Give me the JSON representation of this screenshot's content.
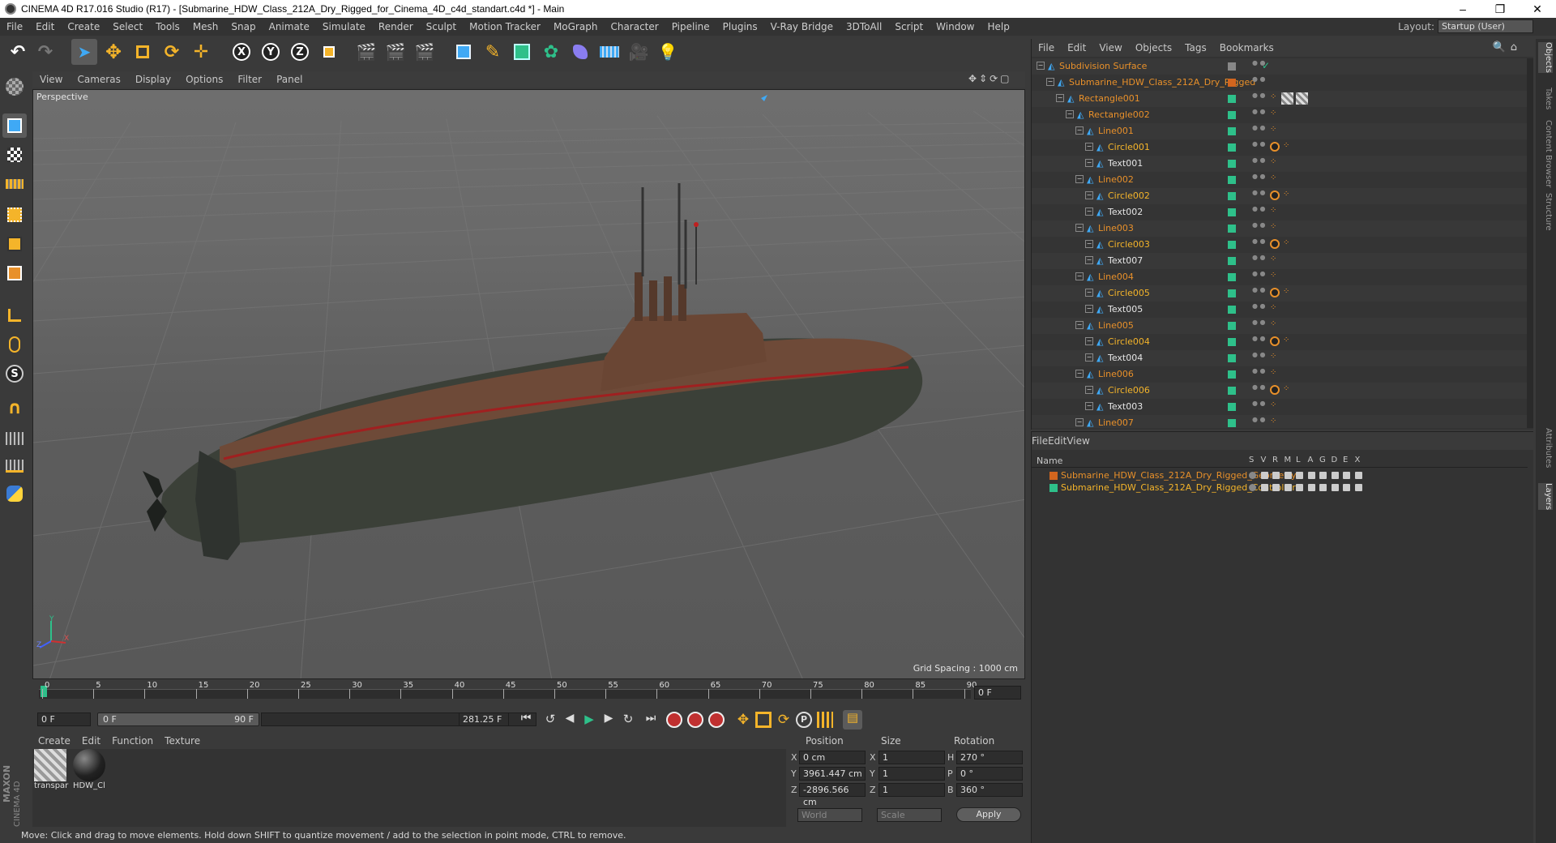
{
  "titlebar": {
    "title": "CINEMA 4D R17.016 Studio (R17) - [Submarine_HDW_Class_212A_Dry_Rigged_for_Cinema_4D_c4d_standart.c4d *] - Main",
    "minimize": "–",
    "restore": "❐",
    "close": "✕"
  },
  "menubar": {
    "items": [
      "File",
      "Edit",
      "Create",
      "Select",
      "Tools",
      "Mesh",
      "Snap",
      "Animate",
      "Simulate",
      "Render",
      "Sculpt",
      "Motion Tracker",
      "MoGraph",
      "Character",
      "Pipeline",
      "Plugins",
      "V-Ray Bridge",
      "3DToAll",
      "Script",
      "Window",
      "Help"
    ],
    "layout_label": "Layout:",
    "layout_value": "Startup (User)"
  },
  "viewport": {
    "menu": [
      "View",
      "Cameras",
      "Display",
      "Options",
      "Filter",
      "Panel"
    ],
    "label": "Perspective",
    "grid_spacing": "Grid Spacing : 1000 cm",
    "axis_x": "X",
    "axis_y": "Y",
    "axis_z": "Z"
  },
  "timeline": {
    "ticks": [
      "0",
      "5",
      "10",
      "15",
      "20",
      "25",
      "30",
      "35",
      "40",
      "45",
      "50",
      "55",
      "60",
      "65",
      "70",
      "75",
      "80",
      "85",
      "90"
    ],
    "end_field": "0 F"
  },
  "anim": {
    "start_field": "0 F",
    "range_start": "0 F",
    "range_end": "90 F",
    "fps_field": "281.25 F"
  },
  "materials": {
    "menu": [
      "Create",
      "Edit",
      "Function",
      "Texture"
    ],
    "items": [
      {
        "label": "transpar"
      },
      {
        "label": "HDW_Cl"
      }
    ],
    "brand_top": "MAXON",
    "brand_bottom": "CINEMA 4D"
  },
  "coords": {
    "headers": {
      "position": "Position",
      "size": "Size",
      "rotation": "Rotation"
    },
    "rows": [
      {
        "axis": "X",
        "pos": "0 cm",
        "size_axis": "X",
        "size": "1",
        "rot_axis": "H",
        "rot": "270 °"
      },
      {
        "axis": "Y",
        "pos": "3961.447 cm",
        "size_axis": "Y",
        "size": "1",
        "rot_axis": "P",
        "rot": "0 °"
      },
      {
        "axis": "Z",
        "pos": "-2896.566 cm",
        "size_axis": "Z",
        "size": "1",
        "rot_axis": "B",
        "rot": "360 °"
      }
    ],
    "mode": "World",
    "scale": "Scale",
    "apply": "Apply"
  },
  "status": {
    "text": "Move: Click and drag to move elements. Hold down SHIFT to quantize movement / add to the selection in point mode, CTRL to remove."
  },
  "objmgr": {
    "menu": [
      "File",
      "Edit",
      "View",
      "Objects",
      "Tags",
      "Bookmarks"
    ],
    "rows": [
      {
        "name": "Subdivision Surface",
        "indent": 0,
        "color": "orange",
        "dot": "#888",
        "check": true,
        "tags": ""
      },
      {
        "name": "Submarine_HDW_Class_212A_Dry_Rigged",
        "indent": 1,
        "color": "orange",
        "dot": "#d2651e",
        "tags": ""
      },
      {
        "name": "Rectangle001",
        "indent": 2,
        "color": "orange",
        "dot": "#2ec08a",
        "tags": "dots,hatch"
      },
      {
        "name": "Rectangle002",
        "indent": 3,
        "color": "orange",
        "dot": "#2ec08a",
        "tags": "dots"
      },
      {
        "name": "Line001",
        "indent": 4,
        "color": "orange",
        "dot": "#2ec08a",
        "tags": "dots"
      },
      {
        "name": "Circle001",
        "indent": 5,
        "color": "yellow",
        "dot": "#2ec08a",
        "tags": "ban,dots"
      },
      {
        "name": "Text001",
        "indent": 5,
        "color": "white",
        "dot": "#2ec08a",
        "tags": "dots"
      },
      {
        "name": "Line002",
        "indent": 4,
        "color": "orange",
        "dot": "#2ec08a",
        "tags": "dots"
      },
      {
        "name": "Circle002",
        "indent": 5,
        "color": "yellow",
        "dot": "#2ec08a",
        "tags": "ban,dots"
      },
      {
        "name": "Text002",
        "indent": 5,
        "color": "white",
        "dot": "#2ec08a",
        "tags": "dots"
      },
      {
        "name": "Line003",
        "indent": 4,
        "color": "orange",
        "dot": "#2ec08a",
        "tags": "dots"
      },
      {
        "name": "Circle003",
        "indent": 5,
        "color": "yellow",
        "dot": "#2ec08a",
        "tags": "ban,dots"
      },
      {
        "name": "Text007",
        "indent": 5,
        "color": "white",
        "dot": "#2ec08a",
        "tags": "dots"
      },
      {
        "name": "Line004",
        "indent": 4,
        "color": "orange",
        "dot": "#2ec08a",
        "tags": "dots"
      },
      {
        "name": "Circle005",
        "indent": 5,
        "color": "yellow",
        "dot": "#2ec08a",
        "tags": "ban,dots"
      },
      {
        "name": "Text005",
        "indent": 5,
        "color": "white",
        "dot": "#2ec08a",
        "tags": "dots"
      },
      {
        "name": "Line005",
        "indent": 4,
        "color": "orange",
        "dot": "#2ec08a",
        "tags": "dots"
      },
      {
        "name": "Circle004",
        "indent": 5,
        "color": "yellow",
        "dot": "#2ec08a",
        "tags": "ban,dots"
      },
      {
        "name": "Text004",
        "indent": 5,
        "color": "white",
        "dot": "#2ec08a",
        "tags": "dots"
      },
      {
        "name": "Line006",
        "indent": 4,
        "color": "orange",
        "dot": "#2ec08a",
        "tags": "dots"
      },
      {
        "name": "Circle006",
        "indent": 5,
        "color": "yellow",
        "dot": "#2ec08a",
        "tags": "ban,dots"
      },
      {
        "name": "Text003",
        "indent": 5,
        "color": "white",
        "dot": "#2ec08a",
        "tags": "dots"
      },
      {
        "name": "Line007",
        "indent": 4,
        "color": "orange",
        "dot": "#2ec08a",
        "tags": "dots"
      }
    ]
  },
  "layermgr": {
    "menu": [
      "File",
      "Edit",
      "View"
    ],
    "header": {
      "name": "Name",
      "cols": [
        "S",
        "V",
        "R",
        "M",
        "L",
        "A",
        "G",
        "D",
        "E",
        "X"
      ]
    },
    "rows": [
      {
        "name": "Submarine_HDW_Class_212A_Dry_Rigged_Geometry",
        "color": "#d2651e",
        "text_color": "orange"
      },
      {
        "name": "Submarine_HDW_Class_212A_Dry_Rigged_Controllers",
        "color": "#2ec08a",
        "text_color": "yellow"
      }
    ]
  },
  "righttabs": [
    "Objects",
    "Takes",
    "Content Browser",
    "Structure",
    "Attributes",
    "Layers"
  ]
}
